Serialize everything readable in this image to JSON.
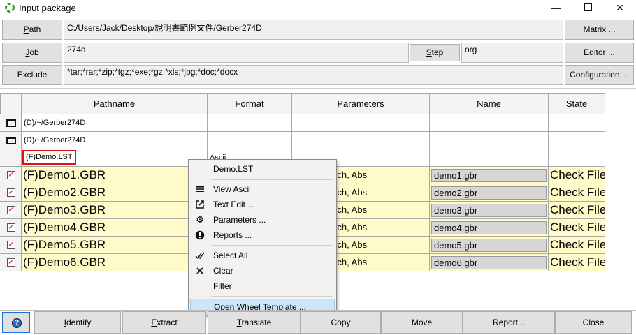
{
  "window": {
    "title": "Input package",
    "minimize": "—",
    "close": "✕"
  },
  "form": {
    "path_label_pre": "",
    "path_label_ul": "P",
    "path_label_post": "ath",
    "path_value": "C:/Users/Jack/Desktop/說明書範例文件/Gerber274D",
    "job_label_ul": "J",
    "job_label_post": "ob",
    "job_value": "274d",
    "step_label_ul": "S",
    "step_label_post": "tep",
    "step_value": "org",
    "exclude_label": "Exclude",
    "exclude_value": "*tar;*rar;*zip;*tgz;*exe;*gz;*xls;*jpg;*doc;*docx",
    "matrix_button": "Matrix ...",
    "editor_button": "Editor ...",
    "config_button": "Configuration ..."
  },
  "table": {
    "headers": [
      "Pathname",
      "Format",
      "Parameters",
      "Name",
      "State"
    ],
    "dir_rows": [
      {
        "path": "(D)/~/Gerber274D"
      },
      {
        "path": "(D)/~/Gerber274D"
      }
    ],
    "lst_row": {
      "path": "(F)Demo.LST",
      "format": "Ascii"
    },
    "file_rows": [
      {
        "path": "(F)Demo1.GBR",
        "params": "ng, 2, 3, Inch, Abs",
        "name": "demo1.gbr",
        "state": "Check File"
      },
      {
        "path": "(F)Demo2.GBR",
        "params": "ng, 2, 3, Inch, Abs",
        "name": "demo2.gbr",
        "state": "Check File"
      },
      {
        "path": "(F)Demo3.GBR",
        "params": "ng, 2, 3, Inch, Abs",
        "name": "demo3.gbr",
        "state": "Check File"
      },
      {
        "path": "(F)Demo4.GBR",
        "params": "ng, 2, 3, Inch, Abs",
        "name": "demo4.gbr",
        "state": "Check File"
      },
      {
        "path": "(F)Demo5.GBR",
        "params": "ng, 2, 3, Inch, Abs",
        "name": "demo5.gbr",
        "state": "Check File"
      },
      {
        "path": "(F)Demo6.GBR",
        "params": "ng, 2, 3, Inch, Abs",
        "name": "demo6.gbr",
        "state": "Check File"
      }
    ]
  },
  "context_menu": {
    "header": "Demo.LST",
    "view_ascii": "View Ascii",
    "text_edit": "Text Edit ...",
    "parameters": "Parameters ...",
    "reports": "Reports ...",
    "select_all": "Select All",
    "clear": "Clear",
    "filter": "Filter",
    "open_wheel": "Open Wheel Template ..."
  },
  "bottom": {
    "help": "?",
    "identify_ul": "I",
    "identify_rest": "dentify",
    "extract_ul": "E",
    "extract_rest": "xtract",
    "translate_ul": "T",
    "translate_rest": "ranslate",
    "copy": "Copy",
    "move": "Move",
    "report": "Report...",
    "close": "Close"
  },
  "colors": {
    "file_row_bg": "#fffbc8",
    "selection_border": "#d11111",
    "menu_highlight": "#cde6f7"
  }
}
